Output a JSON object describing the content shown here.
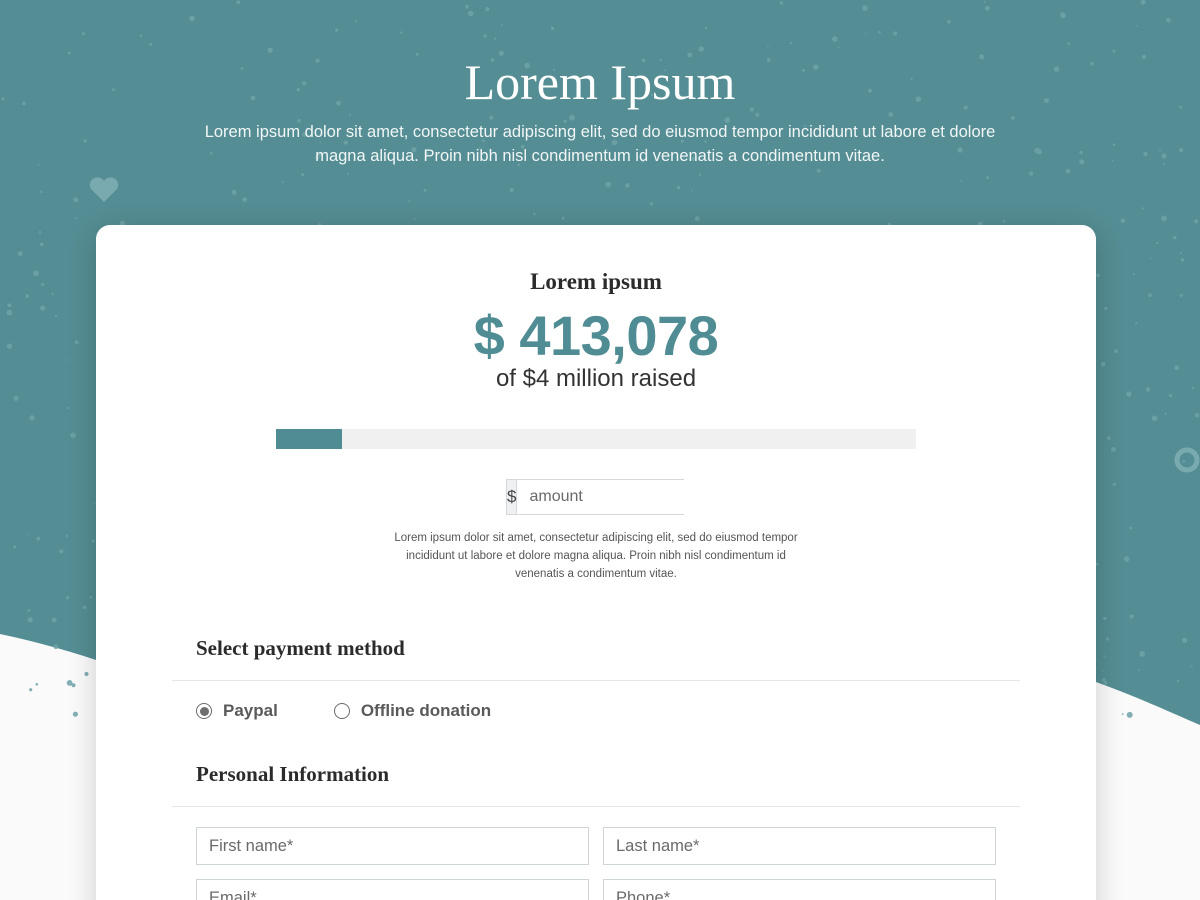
{
  "hero": {
    "title": "Lorem Ipsum",
    "text": "Lorem ipsum dolor sit amet, consectetur adipiscing elit, sed do eiusmod tempor incididunt ut labore et dolore magna aliqua. Proin nibh nisl condimentum id venenatis a condimentum vitae.",
    "decor_icons": [
      "heart-icon",
      "ring-icon"
    ]
  },
  "campaign": {
    "label": "Lorem ipsum",
    "raised": "$ 413,078",
    "goal_text": "of $4 million raised",
    "progress_fraction": 0.103
  },
  "donation": {
    "currency_symbol": "$",
    "amount_placeholder": "amount",
    "note": "Lorem ipsum dolor sit amet, consectetur adipiscing elit, sed do eiusmod tempor incididunt ut labore et dolore magna aliqua. Proin nibh nisl condimentum id venenatis a condimentum vitae."
  },
  "payment": {
    "heading": "Select payment method",
    "options": [
      {
        "label": "Paypal",
        "selected": true
      },
      {
        "label": "Offline donation",
        "selected": false
      }
    ]
  },
  "personal": {
    "heading": "Personal Information",
    "first_name_placeholder": "First name*",
    "last_name_placeholder": "Last name*",
    "email_placeholder": "Email*",
    "phone_placeholder": "Phone*"
  },
  "colors": {
    "accent": "#4f8c93",
    "hero_bg": "#548d93",
    "page_bg": "#fafafa"
  }
}
